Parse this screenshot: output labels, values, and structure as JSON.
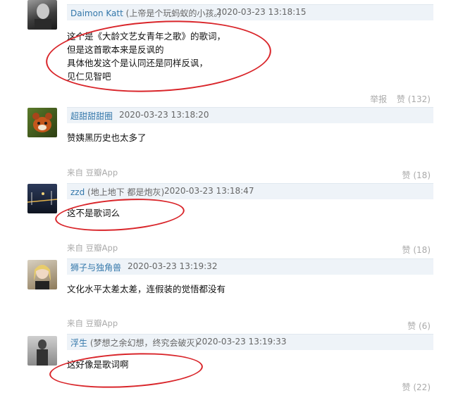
{
  "comments": [
    {
      "username": "Daimon Katt",
      "user_note": "(上帝是个玩蚂蚁的小孩。)",
      "time": "2020-03-23 13:18:15",
      "lines": [
        "这个是《大龄文艺女青年之歌》的歌词，",
        "但是这首歌本来是反讽的",
        "具体他发这个是认同还是同样反讽，",
        "见仁见智吧"
      ],
      "source": "",
      "report": "举报",
      "likes": "赞 (132)"
    },
    {
      "username": "超甜甜甜圈",
      "user_note": "",
      "time": "2020-03-23 13:18:20",
      "lines": [
        "赞姨黑历史也太多了"
      ],
      "source": "来自 豆瓣App",
      "report": "",
      "likes": "赞 (18)"
    },
    {
      "username": "zzd",
      "user_note": "(地上地下 都是炮灰)",
      "time": "2020-03-23 13:18:47",
      "lines": [
        "这不是歌词么"
      ],
      "source": "来自 豆瓣App",
      "report": "",
      "likes": "赞 (18)"
    },
    {
      "username": "狮子与独角兽",
      "user_note": "",
      "time": "2020-03-23 13:19:32",
      "lines": [
        "文化水平太差太差，连假装的觉悟都没有"
      ],
      "source": "来自 豆瓣App",
      "report": "",
      "likes": "赞 (6)"
    },
    {
      "username": "浮生",
      "user_note": "(梦想之余幻想，终究会破灭)",
      "time": "2020-03-23 13:19:33",
      "lines": [
        "这好像是歌词啊"
      ],
      "source": "",
      "report": "",
      "likes": "赞 (22)"
    }
  ],
  "colors": {
    "link": "#3377aa",
    "header_bg": "#eef3f8",
    "meta": "#aaaaaa",
    "annotation": "#d9252a"
  }
}
